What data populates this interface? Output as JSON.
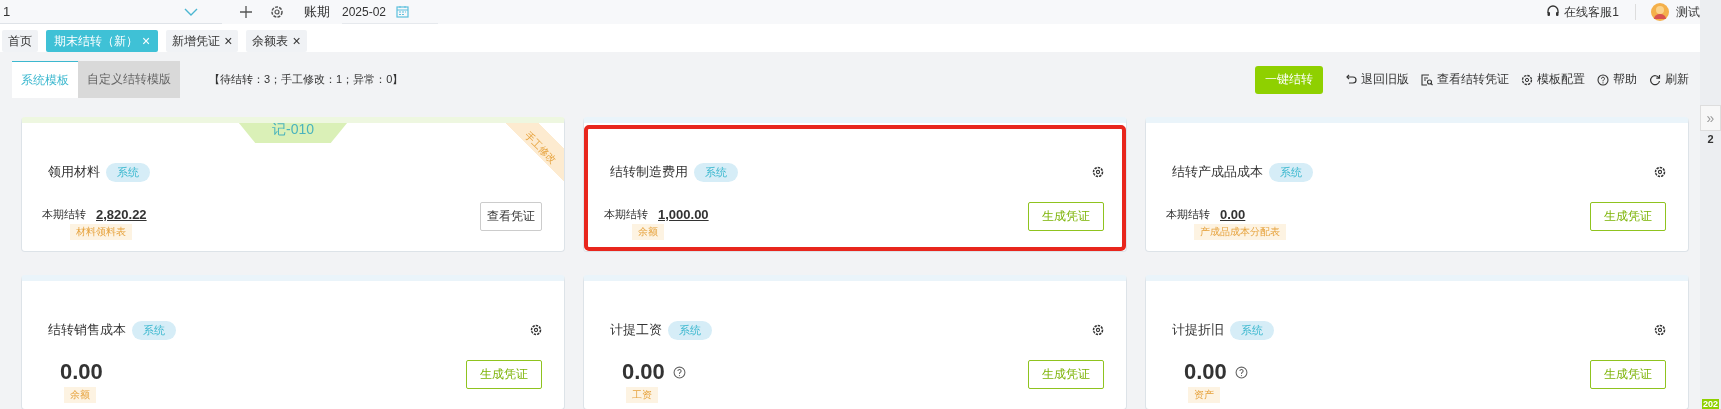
{
  "topbar": {
    "selector_value": "1",
    "period_label": "账期",
    "period_value": "2025-02",
    "support": "在线客服1",
    "user": "测试"
  },
  "tabs": [
    {
      "label": "首页",
      "selected": false
    },
    {
      "label": "期末结转（新）",
      "selected": true,
      "close": "×"
    },
    {
      "label": "新增凭证",
      "selected": false,
      "close": "×"
    },
    {
      "label": "余额表",
      "selected": false,
      "close": "×"
    }
  ],
  "subtabs": [
    {
      "label": "系统模板",
      "selected": true
    },
    {
      "label": "自定义结转模版",
      "selected": false
    }
  ],
  "summary": "【待结转：3；手工修改：1；异常：0】",
  "actions": [
    {
      "label": "一键结转",
      "kind": "primary"
    },
    {
      "label": "退回旧版",
      "kind": "undo"
    },
    {
      "label": "查看结转凭证",
      "kind": "view"
    },
    {
      "label": "模板配置",
      "kind": "settings"
    },
    {
      "label": "帮助",
      "kind": "help"
    },
    {
      "label": "刷新",
      "kind": "refresh"
    }
  ],
  "cards": [
    {
      "kind": "detail",
      "title": "领用材料",
      "tag": "系统",
      "voucher": "记-010",
      "ribbon": "手工修改",
      "settings": false,
      "highlighted": false,
      "period_label": "本期结转",
      "amount": "2,820.22",
      "help": false,
      "source": "材料领料表",
      "button": {
        "label": "查看凭证",
        "kind": "view"
      }
    },
    {
      "kind": "detail",
      "title": "结转制造费用",
      "tag": "系统",
      "settings": true,
      "highlighted": true,
      "period_label": "本期结转",
      "amount": "1,000.00",
      "help": false,
      "source": "余额",
      "button": {
        "label": "生成凭证",
        "kind": "generate"
      }
    },
    {
      "kind": "detail",
      "title": "结转产成品成本",
      "tag": "系统",
      "settings": true,
      "highlighted": false,
      "period_label": "本期结转",
      "amount": "0.00",
      "help": false,
      "source": "产成品成本分配表",
      "button": {
        "label": "生成凭证",
        "kind": "generate"
      }
    },
    {
      "kind": "total",
      "title": "结转销售成本",
      "tag": "系统",
      "settings": true,
      "highlighted": false,
      "amount": "0.00",
      "help": false,
      "source": "余额",
      "button": {
        "label": "生成凭证",
        "kind": "generate"
      }
    },
    {
      "kind": "total",
      "title": "计提工资",
      "tag": "系统",
      "settings": true,
      "highlighted": false,
      "amount": "0.00",
      "help": true,
      "source": "工资",
      "button": {
        "label": "生成凭证",
        "kind": "generate"
      }
    },
    {
      "kind": "total",
      "title": "计提折旧",
      "tag": "系统",
      "settings": true,
      "highlighted": false,
      "amount": "0.00",
      "help": true,
      "source": "资产",
      "button": {
        "label": "生成凭证",
        "kind": "generate"
      }
    }
  ],
  "side_panel": {
    "toggle": "»",
    "text": "2",
    "badge": "202"
  }
}
